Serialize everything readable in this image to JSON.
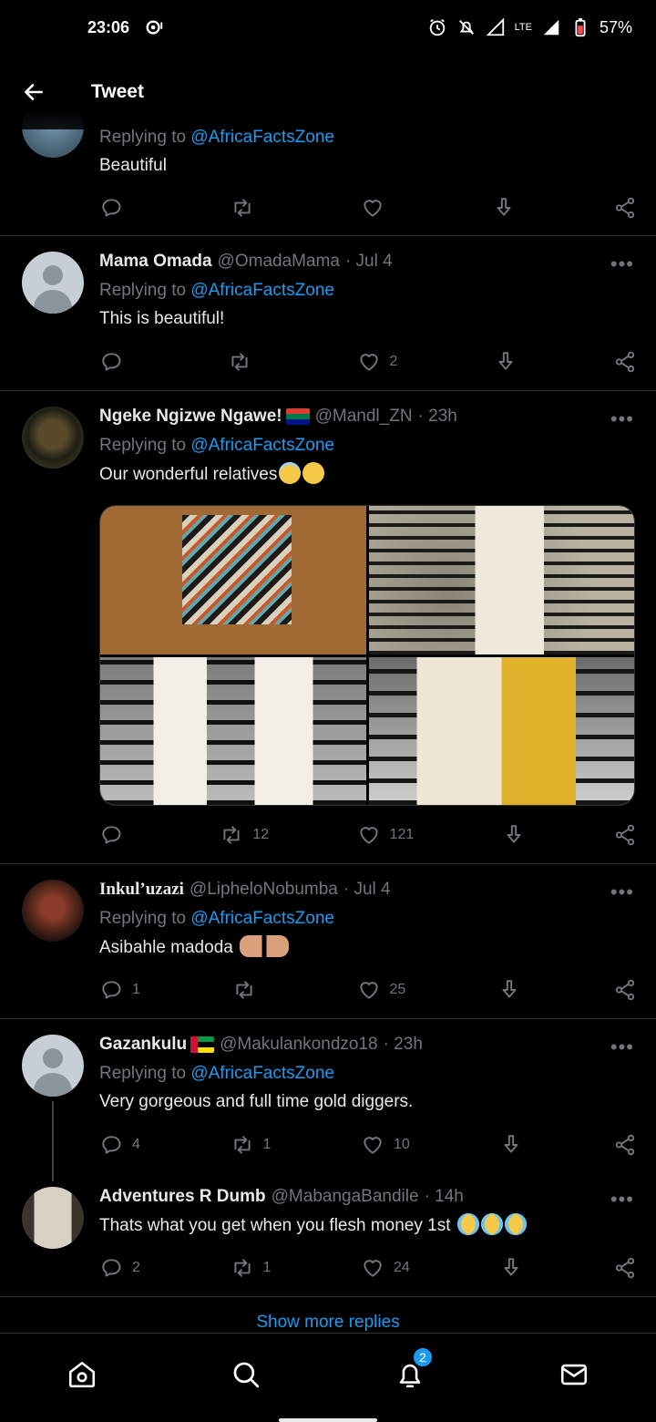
{
  "status_bar": {
    "time": "23:06",
    "lte": "LTE",
    "battery": "57%"
  },
  "header": {
    "title": "Tweet"
  },
  "tweets": [
    {
      "id": "partial",
      "reply_prefix": "Replying to",
      "reply_handle": "@AfricaFactsZone",
      "text": "Beautiful",
      "replies": "",
      "retweets": "",
      "likes": ""
    },
    {
      "id": "mama-omada",
      "name": "Mama Omada",
      "handle": "@OmadaMama",
      "time": "· Jul 4",
      "reply_prefix": "Replying to",
      "reply_handle": "@AfricaFactsZone",
      "text": "This is beautiful!",
      "replies": "",
      "retweets": "",
      "likes": "2"
    },
    {
      "id": "ngeke",
      "name": "Ngeke Ngizwe Ngawe!",
      "handle": "@Mandl_ZN",
      "time": "· 23h",
      "reply_prefix": "Replying to",
      "reply_handle": "@AfricaFactsZone",
      "text": "Our wonderful relatives",
      "replies": "",
      "retweets": "12",
      "likes": "121"
    },
    {
      "id": "inkul",
      "name": "Inkul’uzazi",
      "handle": "@LipheloNobumba",
      "time": "· Jul 4",
      "reply_prefix": "Replying to",
      "reply_handle": "@AfricaFactsZone",
      "text": "Asibahle madoda",
      "replies": "1",
      "retweets": "",
      "likes": "25"
    },
    {
      "id": "gazankulu",
      "name": "Gazankulu",
      "handle": "@Makulankondzo18",
      "time": "· 23h",
      "reply_prefix": "Replying to",
      "reply_handle": "@AfricaFactsZone",
      "text": "Very gorgeous and full time gold diggers.",
      "replies": "4",
      "retweets": "1",
      "likes": "10"
    },
    {
      "id": "adventures",
      "name": "Adventures R Dumb",
      "handle": "@MabangaBandile",
      "time": "· 14h",
      "text": "Thats what you get when you flesh money 1st",
      "replies": "2",
      "retweets": "1",
      "likes": "24"
    }
  ],
  "show_more": "Show more replies",
  "bottom_nav": {
    "notifications_badge": "2"
  },
  "colors": {
    "accent": "#1d9bf0",
    "muted": "#71767b",
    "divider": "#2f3336",
    "text": "#e7e9ea"
  }
}
